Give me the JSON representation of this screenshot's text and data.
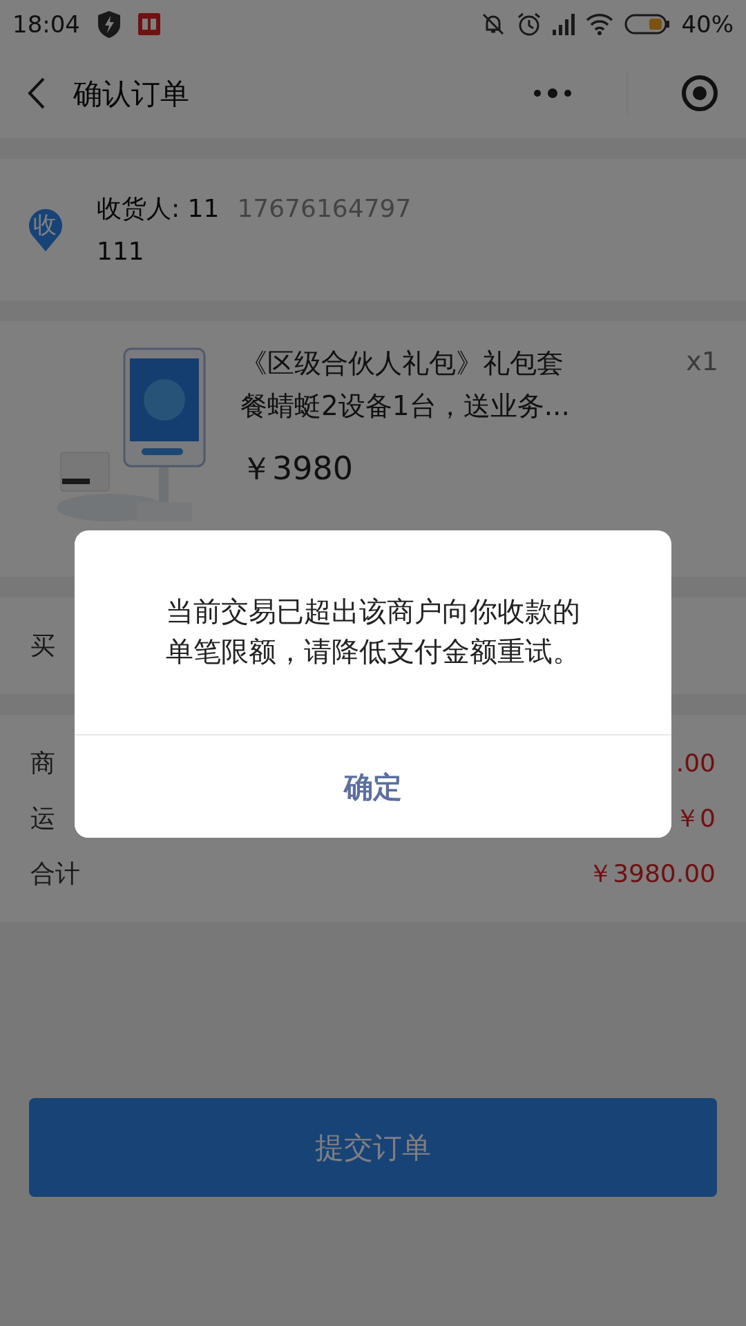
{
  "status_bar": {
    "time": "18:04",
    "battery": "40%"
  },
  "header": {
    "title": "确认订单"
  },
  "address": {
    "icon_text": "收",
    "recipient": "收货人: 11",
    "phone": "17676164797",
    "detail": "111"
  },
  "product": {
    "kind": "picture",
    "title": "《区级合伙人礼包》礼包套餐蜻蜓2设备1台，送业务...",
    "quantity": "x1",
    "price": "￥3980"
  },
  "buyer": {
    "label": "买"
  },
  "summary": [
    {
      "label": "商",
      "value": ".00"
    },
    {
      "label": "运",
      "value": "￥0"
    },
    {
      "label": "合计",
      "value": "￥3980.00"
    }
  ],
  "submit_button": "提交订单",
  "dialog": {
    "message": "当前交易已超出该商户向你收款的单笔限额，请降低支付金额重试。",
    "button": "确定"
  }
}
